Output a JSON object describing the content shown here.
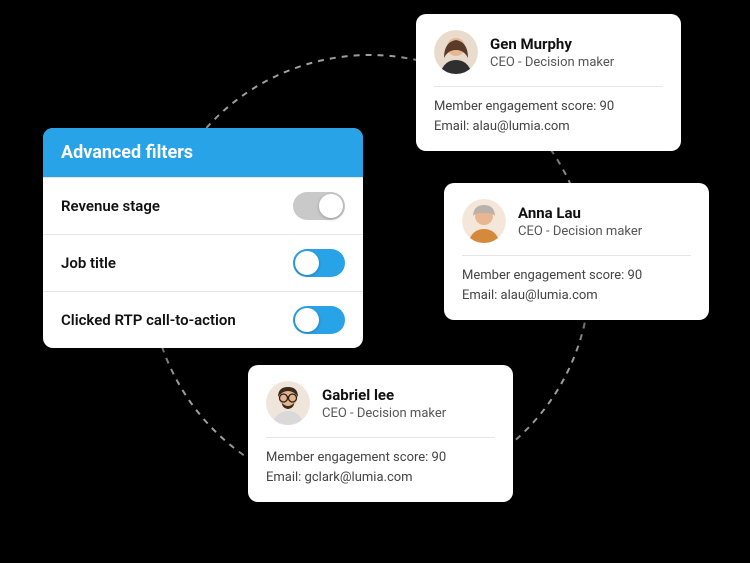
{
  "filters": {
    "heading": "Advanced filters",
    "items": [
      {
        "label": "Revenue stage",
        "on": false
      },
      {
        "label": "Job title",
        "on": true
      },
      {
        "label": "Clicked RTP call-to-action",
        "on": true
      }
    ]
  },
  "people": [
    {
      "name": "Gen Murphy",
      "title": "CEO - Decision maker",
      "score_line": "Member engagement score: 90",
      "email_line": "Email: alau@lumia.com"
    },
    {
      "name": "Anna Lau",
      "title": "CEO - Decision maker",
      "score_line": "Member engagement score: 90",
      "email_line": "Email: alau@lumia.com"
    },
    {
      "name": "Gabriel lee",
      "title": "CEO - Decision maker",
      "score_line": "Member engagement score: 90",
      "email_line": "Email: gclark@lumia.com"
    }
  ]
}
